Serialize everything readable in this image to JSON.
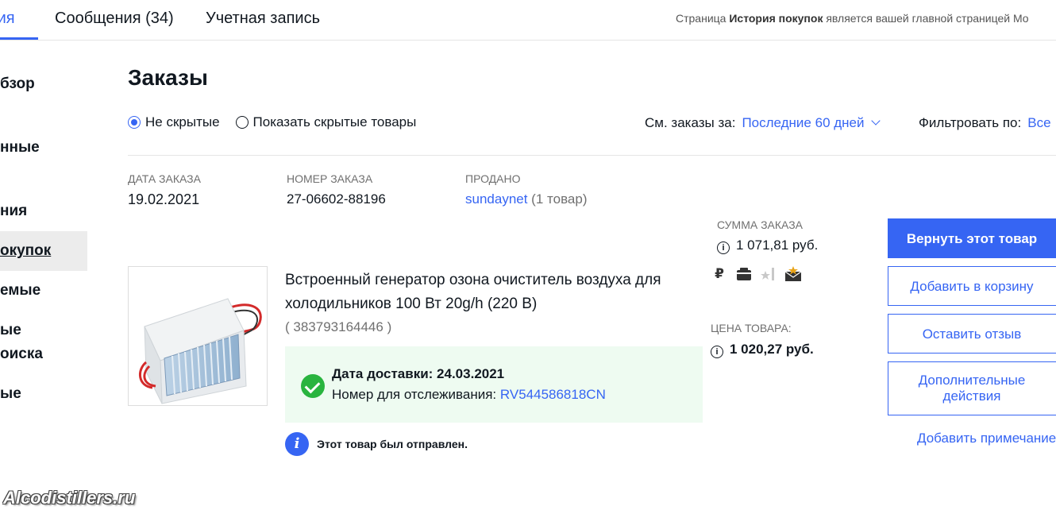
{
  "tabs": [
    {
      "label": "вия"
    },
    {
      "label": "Сообщения (34)"
    },
    {
      "label": "Учетная запись"
    }
  ],
  "homepage_note": {
    "prefix": "Страница ",
    "page_name": "История покупок",
    "suffix": " является вашей главной страницей Мо"
  },
  "sidebar": {
    "items": [
      {
        "label": "бзор"
      },
      {
        "label": "нные"
      },
      {
        "label": "ния"
      },
      {
        "label": "окупок"
      },
      {
        "label": "емые"
      },
      {
        "label": "ые",
        "label2": "оиска"
      },
      {
        "label": "ые"
      }
    ]
  },
  "main": {
    "title": "Заказы",
    "radio_not_hidden": "Не скрытые",
    "radio_show_hidden": "Показать скрытые товары",
    "period_label": "См. заказы за:",
    "period_value": "Последние 60 дней",
    "filter_label": "Фильтровать по:",
    "filter_value": "Все"
  },
  "order": {
    "date_label": "ДАТА ЗАКАЗА",
    "date_value": "19.02.2021",
    "number_label": "НОМЕР ЗАКАЗА",
    "number_value": "27-06602-88196",
    "seller_label": "ПРОДАНО",
    "seller_name": "sundaynet",
    "seller_count": " (1 товар)",
    "sum_label": "СУММА ЗАКАЗА",
    "sum_value": "1 071,81 руб.",
    "price_label": "ЦЕНА ТОВАРА:",
    "price_value": "1 020,27 руб."
  },
  "item": {
    "title": "Встроенный генератор озона очиститель воздуха для холодильников 100 Вт 20g/h (220 В)",
    "item_number": "( 383793164446 )",
    "delivery_date": "Дата доставки: 24.03.2021",
    "tracking_label": "Номер для отслеживания: ",
    "tracking_number": "RV544586818CN",
    "shipped_note": "Этот товар был отправлен."
  },
  "status_icons": [
    "ruble-icon",
    "package-icon",
    "star-icon",
    "envelope-star-icon"
  ],
  "actions": {
    "return": "Вернуть этот товар",
    "cart": "Добавить в корзину",
    "review": "Оставить отзыв",
    "more": "Дополнительные действия",
    "note": "Добавить примечание"
  },
  "watermark": "Alcodistillers.ru",
  "colors": {
    "accent": "#3665f3",
    "success": "#29b43f",
    "success_bg": "#eefbf1",
    "selected_bg": "#ececec"
  }
}
